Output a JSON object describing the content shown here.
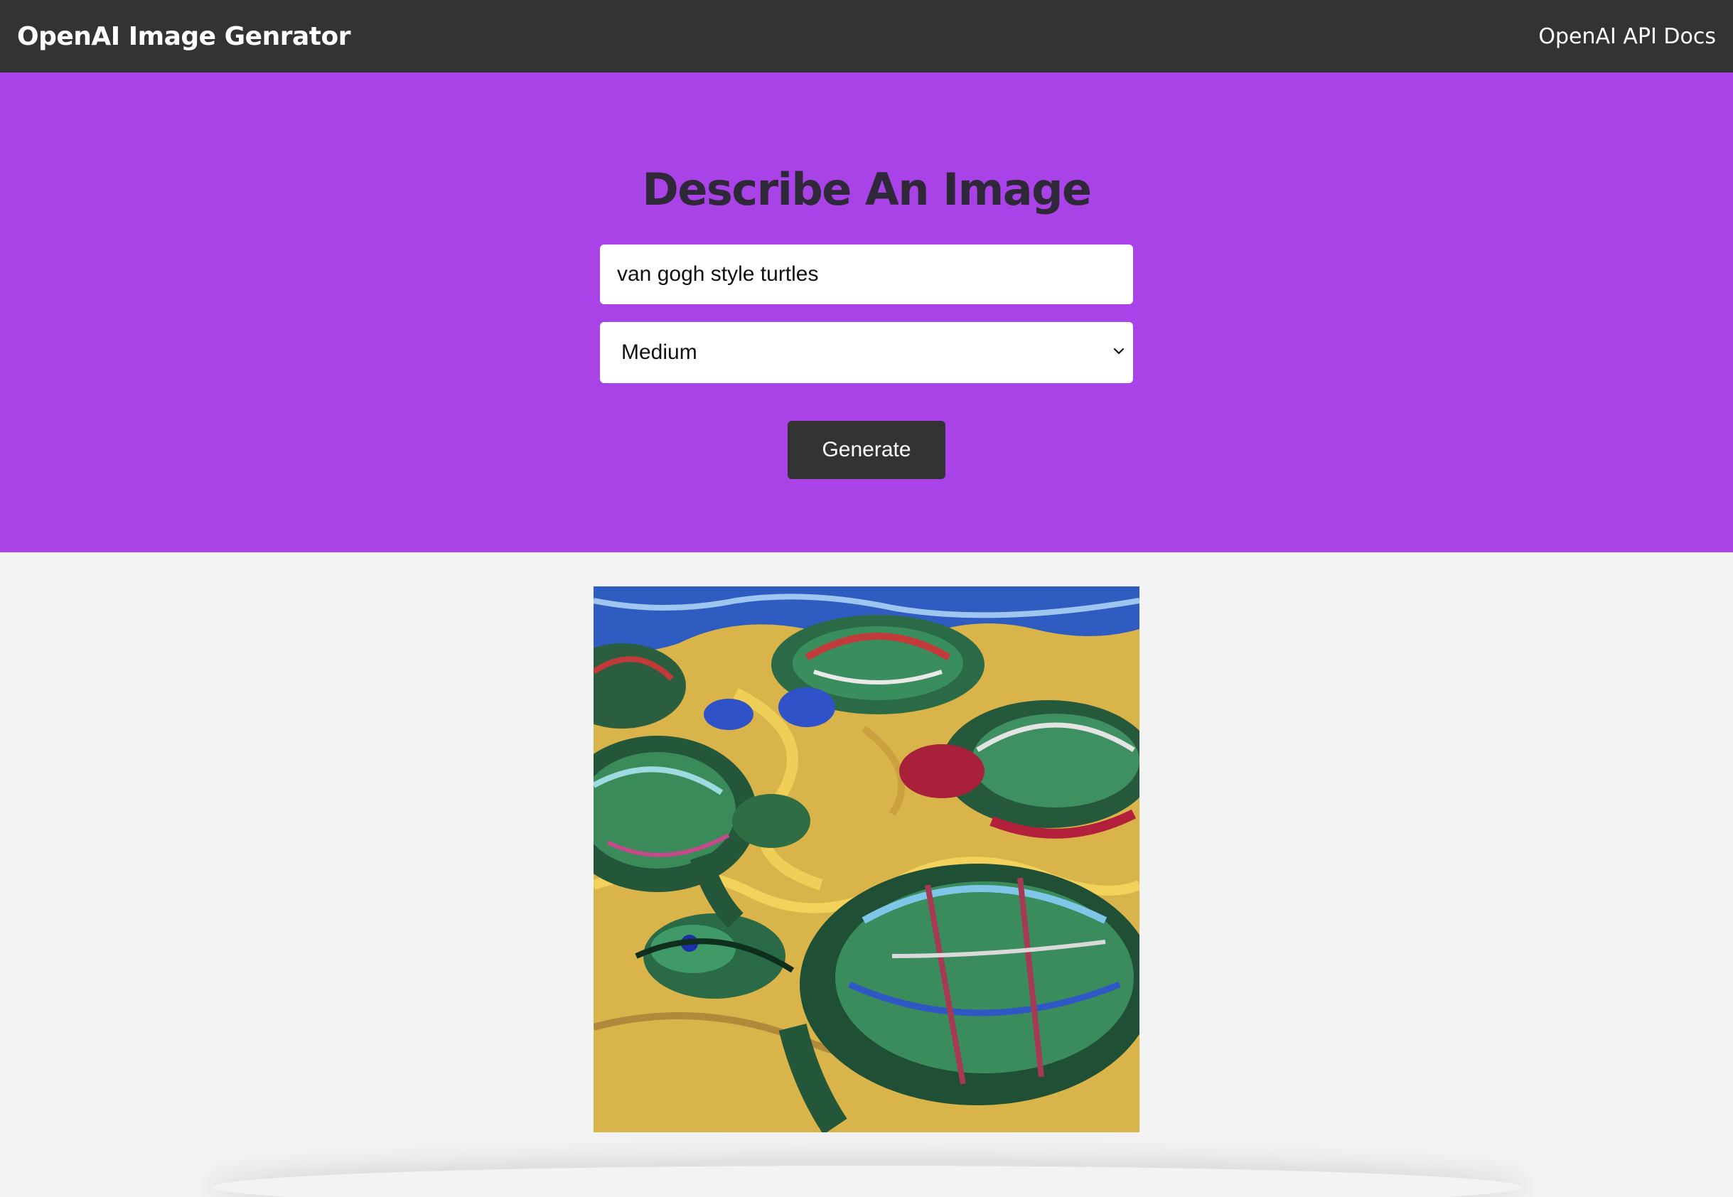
{
  "navbar": {
    "brand": "OpenAI Image Genrator",
    "docs_link": "OpenAI API Docs"
  },
  "form": {
    "title": "Describe An Image",
    "prompt_value": "van gogh style turtles",
    "size_selected": "Medium",
    "generate_label": "Generate"
  },
  "colors": {
    "navbar": "#333333",
    "hero": "#a943e8",
    "page_background": "#f3f3f3",
    "button": "#333333"
  },
  "icons": {
    "select_arrow": "chevron-down-icon"
  }
}
